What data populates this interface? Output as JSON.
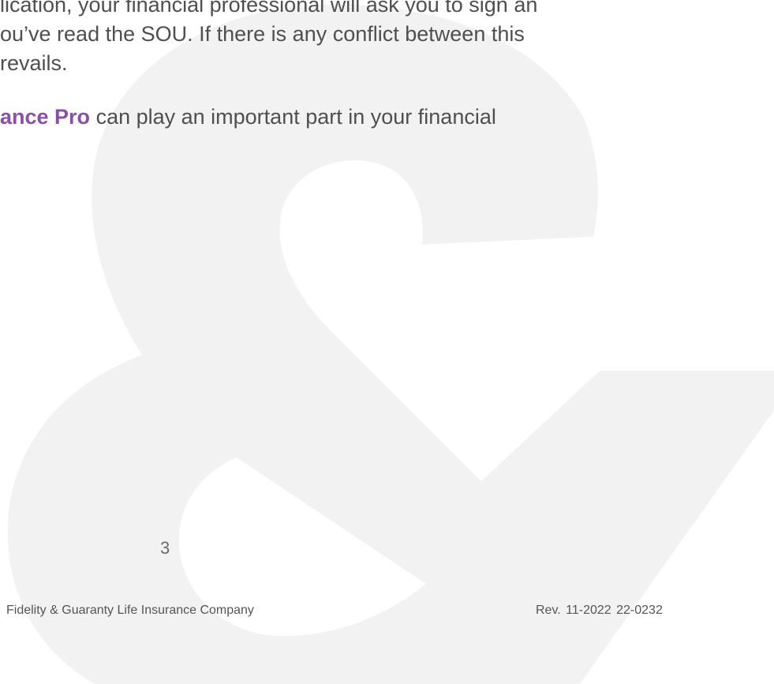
{
  "paragraphs": {
    "p1": {
      "line1": "lication, your financial professional will ask you to sign an",
      "line2": "ou’ve read the SOU. If there is any conflict between this",
      "line3": "revails."
    },
    "p2": {
      "brand": "ance Pro",
      "rest": " can play an important part in your financial"
    }
  },
  "page_number": "3",
  "footer": {
    "company": "Fidelity & Guaranty Life Insurance Company",
    "revision": "Rev. 11-2022  22-0232"
  },
  "colors": {
    "brand_purple": "#8b4fa6",
    "watermark_gray": "#f2f2f2",
    "text": "#4f4f4f"
  }
}
